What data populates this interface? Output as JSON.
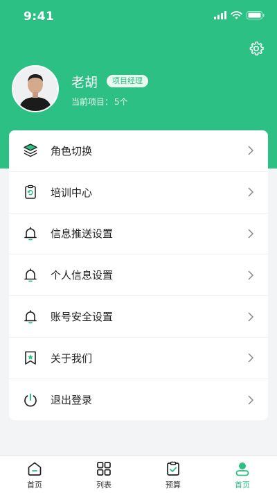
{
  "status_bar": {
    "time": "9:41"
  },
  "profile": {
    "name": "老胡",
    "role": "项目经理",
    "current_project_label": "当前项目：",
    "current_project_value": "5个"
  },
  "menu": {
    "items": [
      {
        "label": "角色切换",
        "icon": "layers-icon"
      },
      {
        "label": "培训中心",
        "icon": "clipboard-refresh-icon"
      },
      {
        "label": "信息推送设置",
        "icon": "bell-icon"
      },
      {
        "label": "个人信息设置",
        "icon": "bell-icon"
      },
      {
        "label": "账号安全设置",
        "icon": "bell-icon"
      },
      {
        "label": "关于我们",
        "icon": "bookmark-star-icon"
      },
      {
        "label": "退出登录",
        "icon": "power-icon"
      }
    ]
  },
  "tabs": [
    {
      "label": "首页",
      "icon": "home-icon"
    },
    {
      "label": "列表",
      "icon": "grid-icon"
    },
    {
      "label": "预算",
      "icon": "clipboard-check-icon"
    },
    {
      "label": "首页",
      "icon": "profile-icon",
      "active": true
    }
  ],
  "colors": {
    "accent": "#2cc084",
    "background": "#f3f4f6"
  }
}
